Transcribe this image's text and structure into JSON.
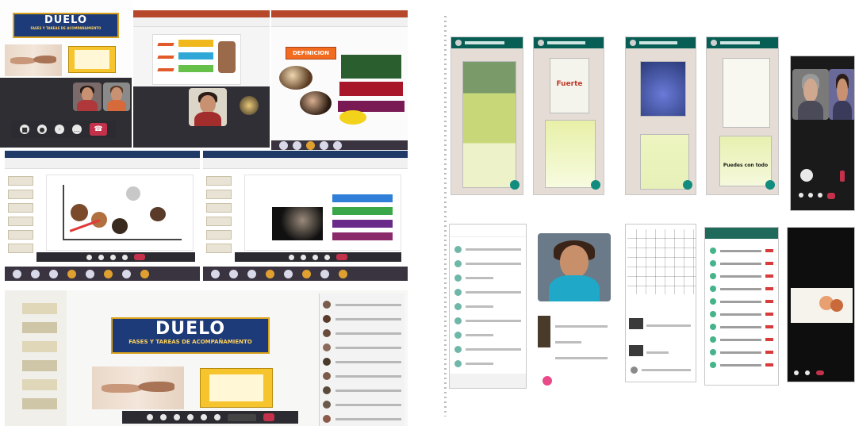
{
  "collage": {
    "title_main": "DUELO",
    "title_sub": "FASES Y TAREAS DE ACOMPAÑAMIENTO",
    "definition_label": "DEFINICION"
  },
  "phone_quotes": {
    "quote_2": "Fuerte",
    "quote_5": "Puedes con todo"
  },
  "colors": {
    "title_bg": "#1d3b78",
    "title_border": "#d9a21a",
    "teams_toolbar": "#2b2b31",
    "end_call": "#c4314b",
    "whatsapp_header": "#075e54",
    "whatsapp_bg": "#e5ddd5"
  },
  "icons": [
    "camera-icon",
    "mic-icon",
    "share-icon",
    "more-icon",
    "hangup-icon",
    "chat-avatar-icon",
    "send-fab-icon"
  ]
}
